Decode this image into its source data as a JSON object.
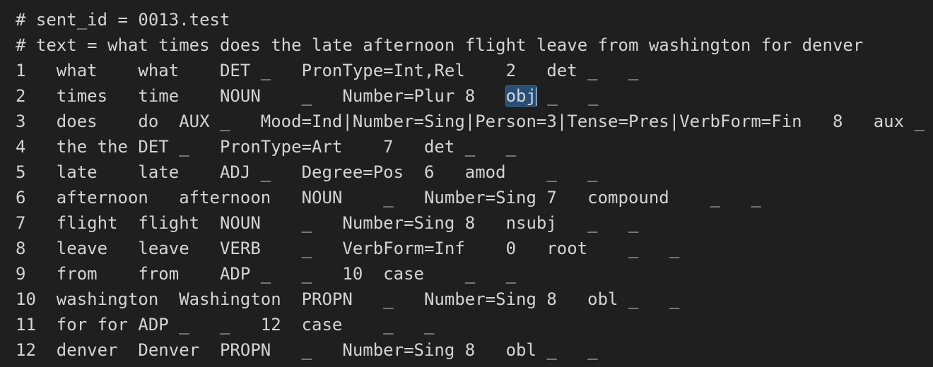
{
  "editor": {
    "lines": [
      "# sent_id = 0013.test",
      "# text = what times does the late afternoon flight leave from washington for denver",
      "1   what    what    DET _   PronType=Int,Rel    2   det _   _",
      {
        "before": "2   times   time    NOUN    _   Number=Plur 8   ",
        "selected": "obj",
        "after": " _   _"
      },
      "3   does    do  AUX _   Mood=Ind|Number=Sing|Person=3|Tense=Pres|VerbForm=Fin   8   aux _",
      "4   the the DET _   PronType=Art    7   det _   _",
      "5   late    late    ADJ _   Degree=Pos  6   amod    _   _",
      "6   afternoon   afternoon   NOUN    _   Number=Sing 7   compound    _   _",
      "7   flight  flight  NOUN    _   Number=Sing 8   nsubj   _   _",
      "8   leave   leave   VERB    _   VerbForm=Inf    0   root    _   _",
      "9   from    from    ADP _   _   10  case    _   _",
      "10  washington  Washington  PROPN   _   Number=Sing 8   obl _   _",
      "11  for for ADP _   _   12  case    _   _",
      "12  denver  Denver  PROPN   _   Number=Sing 8   obl _   _"
    ]
  }
}
